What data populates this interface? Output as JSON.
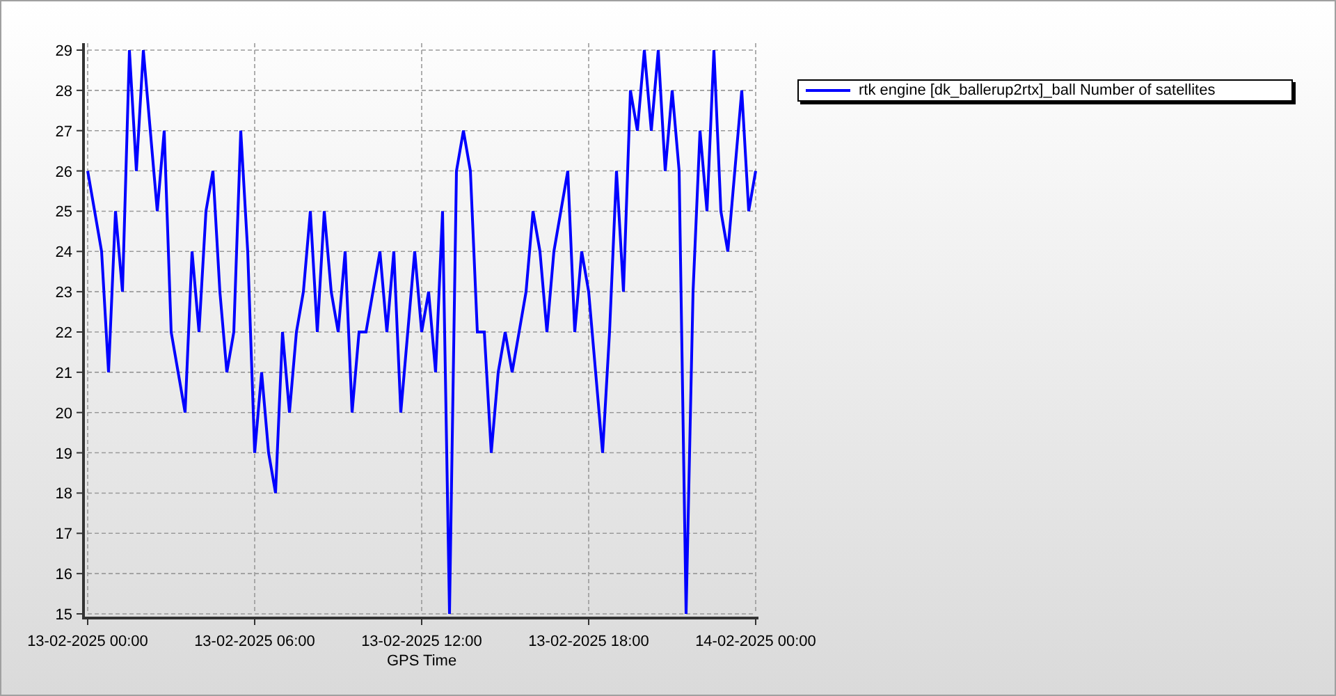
{
  "chart_data": {
    "type": "line",
    "grid": true,
    "xlabel": "GPS Time",
    "ylim": [
      15,
      29
    ],
    "yticks": [
      15,
      16,
      17,
      18,
      19,
      20,
      21,
      22,
      23,
      24,
      25,
      26,
      27,
      28,
      29
    ],
    "categories": [
      "13-02-2025 00:00",
      null,
      null,
      null,
      null,
      null,
      null,
      null,
      null,
      null,
      null,
      null,
      null,
      null,
      null,
      null,
      null,
      null,
      null,
      null,
      null,
      null,
      null,
      null,
      "13-02-2025 06:00",
      null,
      null,
      null,
      null,
      null,
      null,
      null,
      null,
      null,
      null,
      null,
      null,
      null,
      null,
      null,
      null,
      null,
      null,
      null,
      null,
      null,
      null,
      null,
      "13-02-2025 12:00",
      null,
      null,
      null,
      null,
      null,
      null,
      null,
      null,
      null,
      null,
      null,
      null,
      null,
      null,
      null,
      null,
      null,
      null,
      null,
      null,
      null,
      null,
      null,
      "13-02-2025 18:00",
      null,
      null,
      null,
      null,
      null,
      null,
      null,
      null,
      null,
      null,
      null,
      null,
      null,
      null,
      null,
      null,
      null,
      null,
      null,
      null,
      null,
      null,
      null,
      "14-02-2025 00:00"
    ],
    "series": [
      {
        "name": "rtk engine [dk_ballerup2rtx]_ball Number of satellites",
        "color": "#0000ff",
        "values": [
          26,
          25,
          24,
          21,
          25,
          23,
          29,
          26,
          29,
          27,
          25,
          27,
          22,
          21,
          20,
          24,
          22,
          25,
          26,
          23,
          21,
          22,
          27,
          24,
          19,
          21,
          19,
          18,
          22,
          20,
          22,
          23,
          25,
          22,
          25,
          23,
          22,
          24,
          20,
          22,
          22,
          23,
          24,
          22,
          24,
          20,
          22,
          24,
          22,
          23,
          21,
          25,
          15,
          26,
          27,
          26,
          22,
          22,
          19,
          21,
          22,
          21,
          22,
          23,
          25,
          24,
          22,
          24,
          25,
          26,
          22,
          24,
          23,
          21,
          19,
          22,
          26,
          23,
          28,
          27,
          29,
          27,
          29,
          26,
          28,
          26,
          15,
          23,
          27,
          25,
          29,
          25,
          24,
          26,
          28,
          25,
          26
        ]
      }
    ]
  }
}
